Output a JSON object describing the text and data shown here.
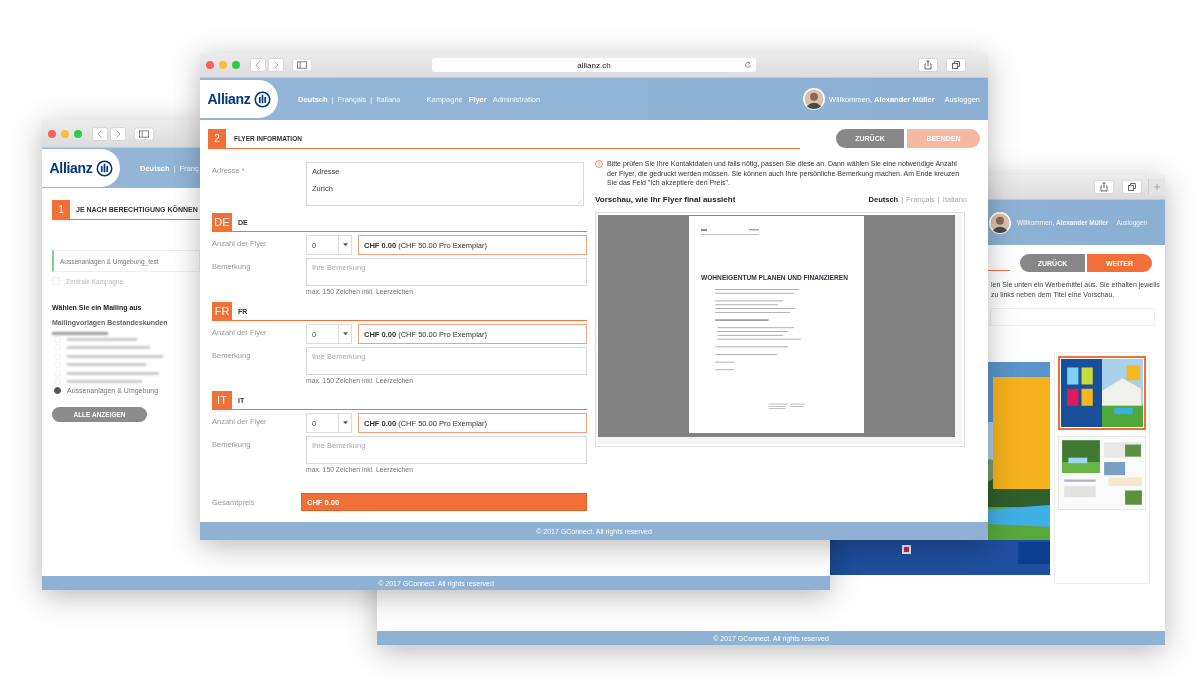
{
  "right_window": {
    "user": {
      "greeting": "Willkommen, **Alexander Müller**",
      "logout": "Ausloggen"
    },
    "buttons": [
      {
        "label": "ZURÜCK",
        "kind": "secondary"
      },
      {
        "label": "WEITER",
        "kind": "primary"
      }
    ],
    "instructions": "len Sie unten ein Werbemittel aus. Sie erhalten jeweils zu links neben dem Titel eine Vorschau.",
    "thumbnails": [
      {
        "selected": true
      },
      {
        "selected": false
      }
    ],
    "footer": "© 2017 GConnect. All rights reserved"
  },
  "left_window": {
    "logo": "Allianz",
    "languages": [
      {
        "label": "Deutsch",
        "selected": true
      },
      {
        "separator": "|",
        "label": "Franç",
        "selected": false
      }
    ],
    "step": {
      "number": "1",
      "title": "JE NACH BERECHTIGUNG KÖNNEN"
    },
    "campaign_field": "Aussenanlagen & Umgebung_test",
    "central_campaign": {
      "label": "Zentrale Kampagne",
      "checked": false
    },
    "mailing_heading": "Wählen Sie ein Mailing aus",
    "templates_heading": "Mailingvorlagen Bestandeskunden",
    "options": [
      {
        "selected": false
      },
      {
        "selected": false
      },
      {
        "selected": false
      },
      {
        "selected": false
      },
      {
        "selected": false
      },
      {
        "selected": false
      },
      {
        "label": "Aussenanlagen & Umgebung",
        "selected": true
      }
    ],
    "show_all_button": "ALLE ANZEIGEN",
    "footer": "© 2017 GConnect. All rights reserved"
  },
  "front_window": {
    "url": "allianz.ch",
    "logo": "Allianz",
    "languages": [
      {
        "label": "Deutsch",
        "selected": true
      },
      {
        "separator": "|",
        "label": "Français",
        "selected": false
      },
      {
        "separator": "|",
        "label": "Italiano",
        "selected": false
      }
    ],
    "nav": [
      {
        "label": "Kampagne",
        "selected": false
      },
      {
        "label": "Flyer",
        "selected": true
      },
      {
        "label": "Administration",
        "selected": false
      }
    ],
    "user": {
      "greeting": "Willkommen, **Alexander Müller**",
      "logout": "Ausloggen"
    },
    "step": {
      "number": "2",
      "title": "FLYER INFORMATION"
    },
    "buttons": [
      {
        "label": "ZURÜCK",
        "kind": "secondary",
        "disabled": false
      },
      {
        "label": "BEENDEN",
        "kind": "primary",
        "disabled": true
      }
    ],
    "address": {
      "label": "Adresse *",
      "lines": [
        "Adresse",
        "Zurich"
      ]
    },
    "sections": [
      {
        "code": "DE",
        "title": "DE",
        "count_label": "Anzahl der Flyer",
        "count": "0",
        "price": "**CHF 0.00** (CHF 50.00 Pro Exemplar)",
        "remark_label": "Bemerkung",
        "remark_placeholder": "Ihre Bemerkung",
        "hint": "max. 150 Zeichen inkl. Leerzeichen"
      },
      {
        "code": "FR",
        "title": "FR",
        "count_label": "Anzahl der Flyer",
        "count": "0",
        "price": "**CHF 0.00** (CHF 50.00 Pro Exemplar)",
        "remark_label": "Bemerkung",
        "remark_placeholder": "Ihre Bemerkung",
        "hint": "max. 150 Zeichen inkl. Leerzeichen"
      },
      {
        "code": "IT",
        "title": "IT",
        "count_label": "Anzahl der Flyer",
        "count": "0",
        "price": "**CHF 0.00** (CHF 50.00 Pro Exemplar)",
        "remark_label": "Bemerkung",
        "remark_placeholder": "Ihre Bemerkung",
        "hint": "max. 150 Zeichen inkl. Leerzeichen"
      }
    ],
    "total": {
      "label": "Gesamtpreis",
      "value": "CHF 0.00"
    },
    "info": "Bitte prüfen Sie Ihre Kontaktdaten und falls nötig, passen Sie diese an. Dann wählen Sie eine notwendige Anzahl der Flyer, die gedruckt werden müssen. Sie können auch Ihre persönliche Bemerkung machen. Am Ende kreuzen Sie das Feld \"Ich akzeptiere den Preis\".",
    "preview": {
      "title": "Vorschau, wie Ihr Flyer final aussieht",
      "languages": [
        {
          "label": "Deutsch",
          "selected": true
        },
        {
          "separator": "|",
          "label": "Français",
          "selected": false
        },
        {
          "separator": "|",
          "label": "Italiano",
          "selected": false
        }
      ],
      "document_heading": "WOHNEIGENTUM PLANEN UND FINANZIEREN"
    },
    "footer": "© 2017 GConnect. All rights reserved"
  }
}
